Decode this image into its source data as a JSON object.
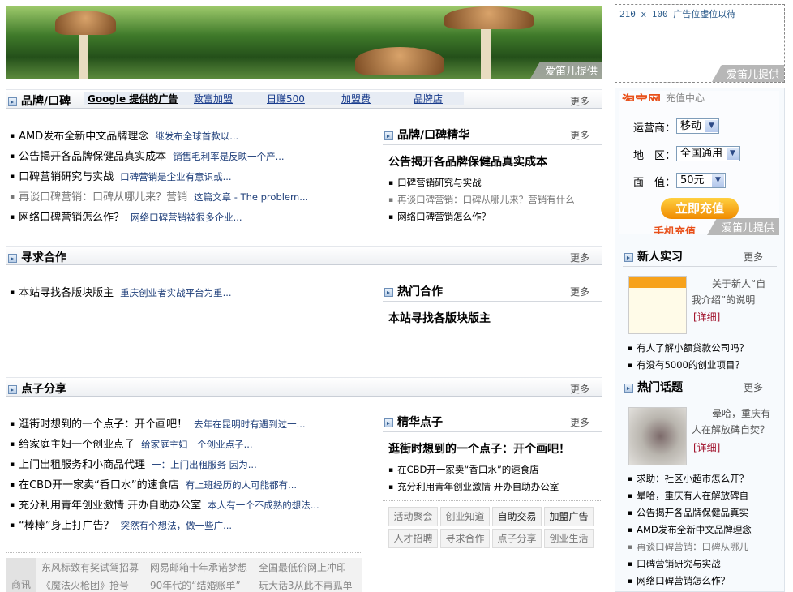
{
  "banner": {
    "credit": "爱笛儿提供"
  },
  "ad_box": {
    "text": "210 x 100 广告位虚位以待",
    "credit": "爱笛儿提供"
  },
  "sections": {
    "brand": {
      "title": "品牌/口碑",
      "more": "更多",
      "google_ads": {
        "label": "Google 提供的广告",
        "links": [
          "致富加盟",
          "日赚500",
          "加盟费",
          "品牌店"
        ]
      },
      "items": [
        {
          "title": "AMD发布全新中文品牌理念",
          "summary": "继发布全球首款以..."
        },
        {
          "title": "公告揭开各品牌保健品真实成本",
          "summary": "销售毛利率是反映一个产..."
        },
        {
          "title": "口碑营销研究与实战",
          "summary": "口碑营销是企业有意识或..."
        },
        {
          "title": "再谈口碑营销：口碑从哪儿来？营销",
          "summary": "这篇文章 - The problem...",
          "visited": true
        },
        {
          "title": "网络口碑营销怎么作？",
          "summary": "网络口碑营销被很多企业..."
        }
      ],
      "featured": {
        "title": "品牌/口碑精华",
        "more": "更多",
        "headline": "公告揭开各品牌保健品真实成本",
        "items": [
          "口碑营销研究与实战",
          "再谈口碑营销：口碑从哪儿来？营销有什么",
          "网络口碑营销怎么作？"
        ]
      }
    },
    "coop": {
      "title": "寻求合作",
      "more": "更多",
      "items": [
        {
          "title": "本站寻找各版块版主",
          "summary": "重庆创业者实战平台为重..."
        }
      ],
      "featured": {
        "title": "热门合作",
        "more": "更多",
        "headline": "本站寻找各版块版主"
      }
    },
    "ideas": {
      "title": "点子分享",
      "more": "更多",
      "items": [
        {
          "title": "逛街时想到的一个点子：开个画吧！",
          "summary": "去年在昆明时有遇到过一..."
        },
        {
          "title": "给家庭主妇一个创业点子",
          "summary": "给家庭主妇一个创业点子..."
        },
        {
          "title": "上门出租服务和小商品代理",
          "summary": "一：上门出租服务 因为..."
        },
        {
          "title": "在CBD开一家卖“香口水”的速食店",
          "summary": "有上班经历的人可能都有..."
        },
        {
          "title": "充分利用青年创业激情 开办自助办公室",
          "summary": "本人有一个不成熟的想法..."
        },
        {
          "title": "“棒棒”身上打广告？",
          "summary": "突然有个想法，做一些广..."
        }
      ],
      "featured": {
        "title": "精华点子",
        "more": "更多",
        "headline": "逛街时想到的一个点子：开个画吧！",
        "items": [
          "在CBD开一家卖“香口水”的速食店",
          "充分利用青年创业激情 开办自助办公室"
        ]
      },
      "tags": [
        "活动聚会",
        "创业知道",
        "自助交易",
        "加盟广告",
        "人才招聘",
        "寻求合作",
        "点子分享",
        "创业生活"
      ]
    }
  },
  "business_news": {
    "label": "商讯",
    "items": [
      "东风标致有奖试驾招募",
      "网易邮箱十年承诺梦想",
      "全国最低价网上冲印",
      "《魔法火枪团》抢号",
      "90年代的“结婚账单”",
      "玩大话3从此不再孤单"
    ]
  },
  "recharge": {
    "logo": "淘宝网",
    "logo_sub": "充值中心",
    "carrier_label": "运营商：",
    "carrier": "移动",
    "region_label": "地　区：",
    "region": "全国通用",
    "amount_label": "面　值：",
    "amount": "50元",
    "submit": "立即充值",
    "footer": "手机充值",
    "credit": "爱笛儿提供"
  },
  "intern": {
    "title": "新人实习",
    "more": "更多",
    "feature": "关于新人“自我介绍”的说明",
    "detail": "[详细]",
    "items": [
      "有人了解小额贷款公司吗？",
      "有没有5000的创业项目？"
    ]
  },
  "hot": {
    "title": "热门话题",
    "more": "更多",
    "feature": "晕哈，重庆有人在解放碑自焚？",
    "detail": "[详细]",
    "items": [
      "求助：社区小超市怎么开？",
      "晕哈，重庆有人在解放碑自",
      "公告揭开各品牌保健品真实",
      "AMD发布全新中文品牌理念",
      "再谈口碑营销：口碑从哪儿",
      "口碑营销研究与实战",
      "网络口碑营销怎么作？"
    ]
  }
}
